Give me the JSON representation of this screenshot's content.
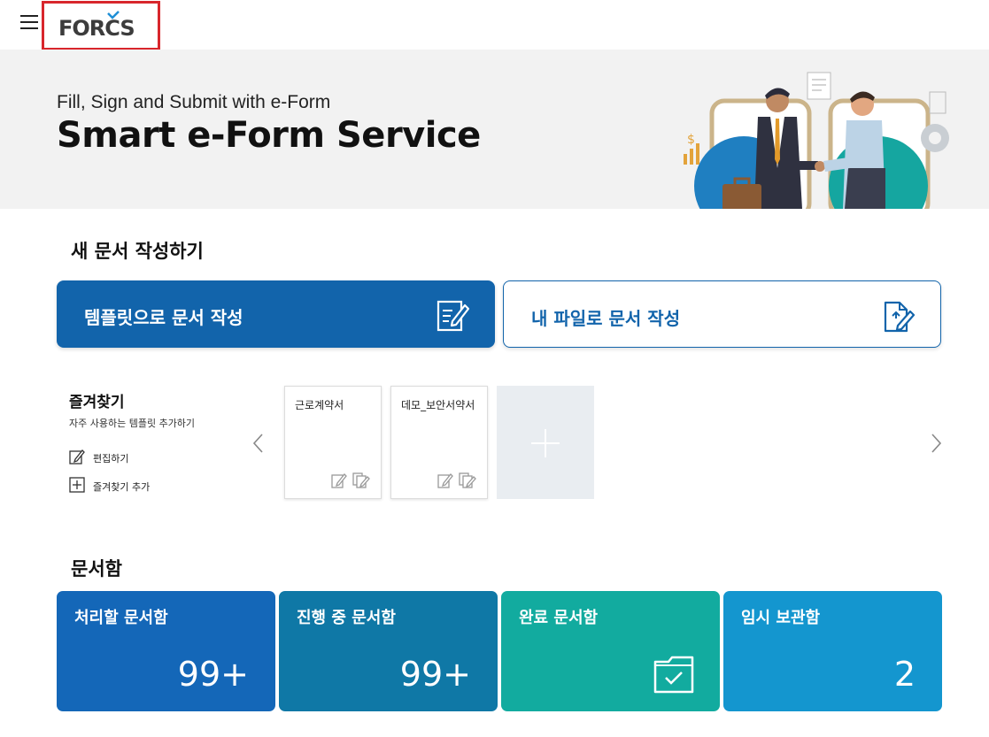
{
  "header": {
    "menu_icon": "hamburger-icon",
    "logo_text": "FORCS"
  },
  "hero": {
    "subtitle": "Fill, Sign and Submit with e-Form",
    "title": "Smart e-Form Service"
  },
  "new_document": {
    "section_title": "새 문서 작성하기",
    "template_button": "템플릿으로 문서 작성",
    "myfile_button": "내 파일로 문서 작성"
  },
  "favorites": {
    "title": "즐겨찾기",
    "description": "자주 사용하는 템플릿 추가하기",
    "edit_label": "편집하기",
    "add_label": "즐겨찾기 추가",
    "cards": [
      {
        "title": "근로계약서"
      },
      {
        "title": "데모_보안서약서"
      }
    ]
  },
  "document_box": {
    "section_title": "문서함",
    "boxes": [
      {
        "title": "처리할 문서함",
        "count": "99+",
        "color": "#1467b8"
      },
      {
        "title": "진행 중 문서함",
        "count": "99+",
        "color": "#0f78a6"
      },
      {
        "title": "완료 문서함",
        "count": "",
        "color": "#12ab9f",
        "icon": "folder-check-icon"
      },
      {
        "title": "임시 보관함",
        "count": "2",
        "color": "#1496cf"
      }
    ]
  },
  "colors": {
    "primary": "#1264ab",
    "logo_border": "#d8262c",
    "hero_bg": "#f2f2f2"
  }
}
